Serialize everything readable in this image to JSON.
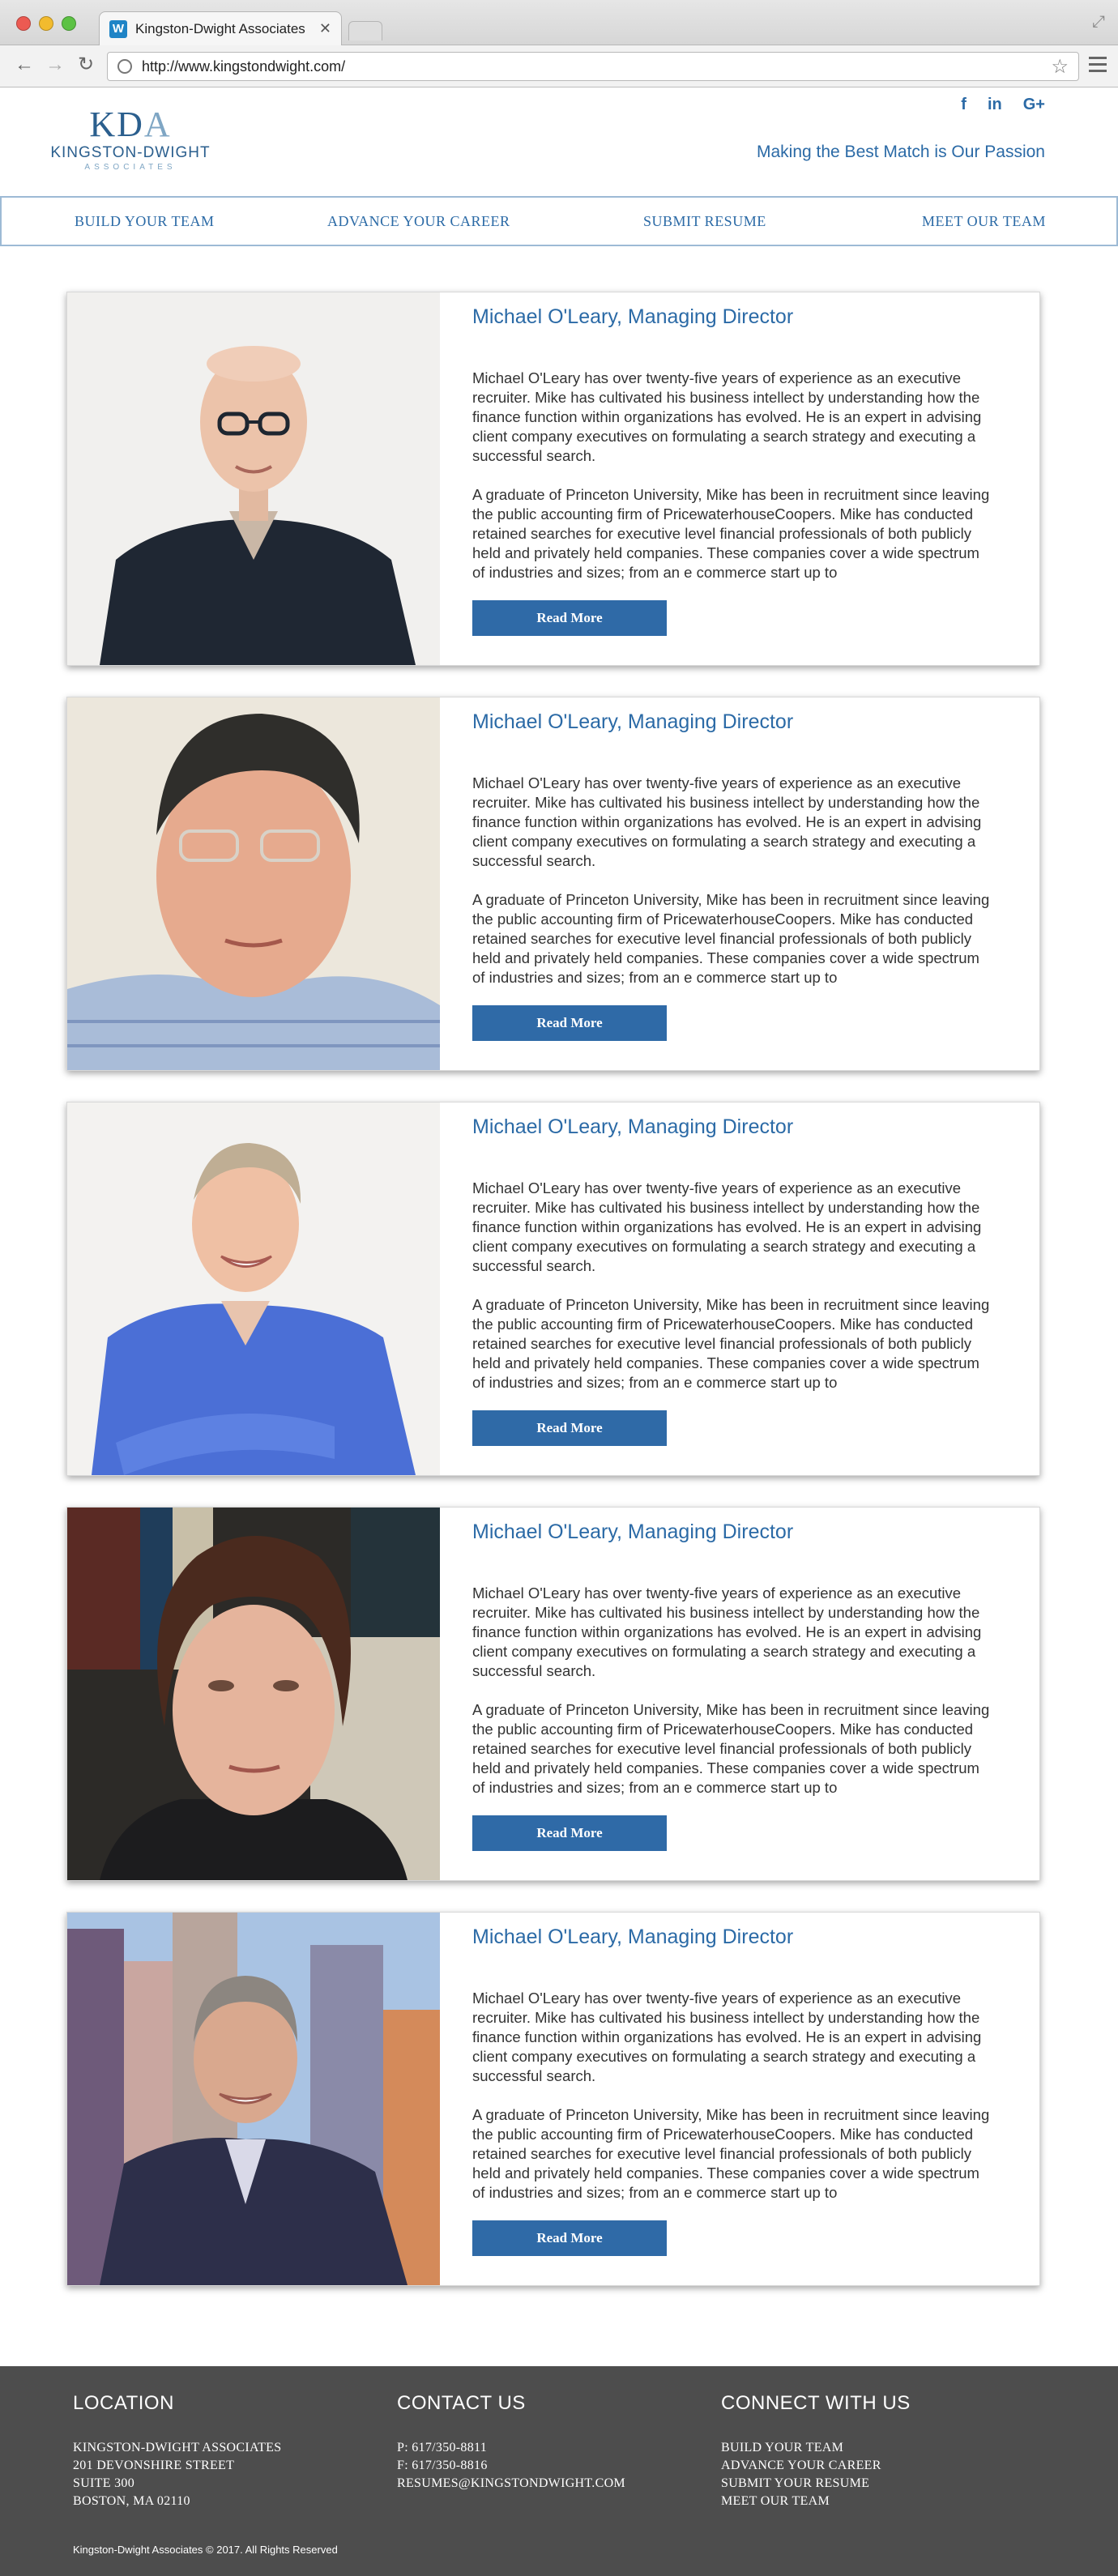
{
  "browser": {
    "tab_title": "Kingston-Dwight Associates",
    "tab_favicon": "W",
    "url": "http://www.kingstondwight.com/"
  },
  "header": {
    "logo_mark_k": "KD",
    "logo_mark_a": "A",
    "logo_name": "KINGSTON-DWIGHT",
    "logo_sub": "ASSOCIATES",
    "social": [
      "f",
      "in",
      "G+"
    ],
    "tagline": "Making the Best Match is Our Passion"
  },
  "nav": {
    "items": [
      "BUILD YOUR TEAM",
      "ADVANCE YOUR CAREER",
      "SUBMIT RESUME",
      "MEET OUR TEAM"
    ]
  },
  "team": [
    {
      "name": "Michael O'Leary, Managing Director",
      "p1": "Michael O'Leary has over twenty-five years of experience as an executive recruiter. Mike has cultivated his business intellect by understanding how the finance function within organizations has evolved. He is an expert in advising client company executives on formulating a search strategy and executing a successful search.",
      "p2": "A graduate of Princeton University, Mike has been in recruitment since leaving the public accounting firm of PricewaterhouseCoopers. Mike has conducted retained searches for executive level financial professionals of both publicly held and privately held companies. These companies cover a wide spectrum of industries and sizes; from an e commerce start up to",
      "button": "Read More"
    },
    {
      "name": "Michael O'Leary, Managing Director",
      "p1": "Michael O'Leary has over twenty-five years of experience as an executive recruiter. Mike has cultivated his business intellect by understanding how the finance function within organizations has evolved. He is an expert in advising client company executives on formulating a search strategy and executing a successful search.",
      "p2": "A graduate of Princeton University, Mike has been in recruitment since leaving the public accounting firm of PricewaterhouseCoopers. Mike has conducted retained searches for executive level financial professionals of both publicly held and privately held companies. These companies cover a wide spectrum of industries and sizes; from an e commerce start up to",
      "button": "Read More"
    },
    {
      "name": "Michael O'Leary, Managing Director",
      "p1": "Michael O'Leary has over twenty-five years of experience as an executive recruiter. Mike has cultivated his business intellect by understanding how the finance function within organizations has evolved. He is an expert in advising client company executives on formulating a search strategy and executing a successful search.",
      "p2": "A graduate of Princeton University, Mike has been in recruitment since leaving the public accounting firm of PricewaterhouseCoopers. Mike has conducted retained searches for executive level financial professionals of both publicly held and privately held companies. These companies cover a wide spectrum of industries and sizes; from an e commerce start up to",
      "button": "Read More"
    },
    {
      "name": "Michael O'Leary, Managing Director",
      "p1": "Michael O'Leary has over twenty-five years of experience as an executive recruiter. Mike has cultivated his business intellect by understanding how the finance function within organizations has evolved. He is an expert in advising client company executives on formulating a search strategy and executing a successful search.",
      "p2": "A graduate of Princeton University, Mike has been in recruitment since leaving the public accounting firm of PricewaterhouseCoopers. Mike has conducted retained searches for executive level financial professionals of both publicly held and privately held companies. These companies cover a wide spectrum of industries and sizes; from an e commerce start up to",
      "button": "Read More"
    },
    {
      "name": "Michael O'Leary, Managing Director",
      "p1": "Michael O'Leary has over twenty-five years of experience as an executive recruiter. Mike has cultivated his business intellect by understanding how the finance function within organizations has evolved. He is an expert in advising client company executives on formulating a search strategy and executing a successful search.",
      "p2": "A graduate of Princeton University, Mike has been in recruitment since leaving the public accounting firm of PricewaterhouseCoopers. Mike has conducted retained searches for executive level financial professionals of both publicly held and privately held companies. These companies cover a wide spectrum of industries and sizes; from an e commerce start up to",
      "button": "Read More"
    }
  ],
  "footer": {
    "location": {
      "heading": "LOCATION",
      "lines": [
        "KINGSTON-DWIGHT ASSOCIATES",
        "201 DEVONSHIRE STREET",
        "SUITE 300",
        "BOSTON, MA 02110"
      ]
    },
    "contact": {
      "heading": "CONTACT US",
      "lines": [
        "P: 617/350-8811",
        "F: 617/350-8816",
        "RESUMES@KINGSTONDWIGHT.COM"
      ]
    },
    "connect": {
      "heading": "CONNECT WITH US",
      "lines": [
        "BUILD YOUR TEAM",
        "ADVANCE YOUR CAREER",
        "SUBMIT YOUR RESUME",
        "MEET OUR TEAM"
      ]
    },
    "copyright": "Kingston-Dwight Associates © 2017. All Rights Reserved"
  },
  "colors": {
    "accent": "#2b6aa6",
    "button": "#2f6aa7",
    "footer_bg": "#4d4d4d"
  }
}
